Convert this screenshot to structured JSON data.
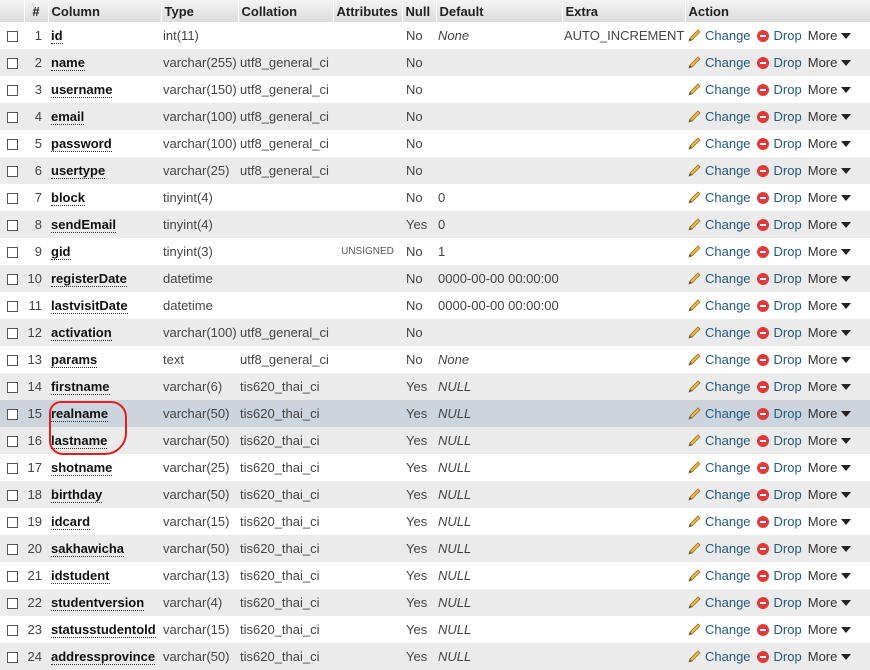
{
  "header": {
    "num": "#",
    "column": "Column",
    "type": "Type",
    "collation": "Collation",
    "attributes": "Attributes",
    "null": "Null",
    "default": "Default",
    "extra": "Extra",
    "action": "Action"
  },
  "actions": {
    "change": "Change",
    "drop": "Drop",
    "more": "More"
  },
  "rows": [
    {
      "num": "1",
      "column": "id",
      "type": "int(11)",
      "collation": "",
      "attributes": "",
      "null": "No",
      "default": "None",
      "extra": "AUTO_INCREMENT"
    },
    {
      "num": "2",
      "column": "name",
      "type": "varchar(255)",
      "collation": "utf8_general_ci",
      "attributes": "",
      "null": "No",
      "default": "",
      "extra": ""
    },
    {
      "num": "3",
      "column": "username",
      "type": "varchar(150)",
      "collation": "utf8_general_ci",
      "attributes": "",
      "null": "No",
      "default": "",
      "extra": ""
    },
    {
      "num": "4",
      "column": "email",
      "type": "varchar(100)",
      "collation": "utf8_general_ci",
      "attributes": "",
      "null": "No",
      "default": "",
      "extra": ""
    },
    {
      "num": "5",
      "column": "password",
      "type": "varchar(100)",
      "collation": "utf8_general_ci",
      "attributes": "",
      "null": "No",
      "default": "",
      "extra": ""
    },
    {
      "num": "6",
      "column": "usertype",
      "type": "varchar(25)",
      "collation": "utf8_general_ci",
      "attributes": "",
      "null": "No",
      "default": "",
      "extra": ""
    },
    {
      "num": "7",
      "column": "block",
      "type": "tinyint(4)",
      "collation": "",
      "attributes": "",
      "null": "No",
      "default": "0",
      "extra": ""
    },
    {
      "num": "8",
      "column": "sendEmail",
      "type": "tinyint(4)",
      "collation": "",
      "attributes": "",
      "null": "Yes",
      "default": "0",
      "extra": ""
    },
    {
      "num": "9",
      "column": "gid",
      "type": "tinyint(3)",
      "collation": "",
      "attributes": "UNSIGNED",
      "null": "No",
      "default": "1",
      "extra": ""
    },
    {
      "num": "10",
      "column": "registerDate",
      "type": "datetime",
      "collation": "",
      "attributes": "",
      "null": "No",
      "default": "0000-00-00 00:00:00",
      "extra": ""
    },
    {
      "num": "11",
      "column": "lastvisitDate",
      "type": "datetime",
      "collation": "",
      "attributes": "",
      "null": "No",
      "default": "0000-00-00 00:00:00",
      "extra": ""
    },
    {
      "num": "12",
      "column": "activation",
      "type": "varchar(100)",
      "collation": "utf8_general_ci",
      "attributes": "",
      "null": "No",
      "default": "",
      "extra": ""
    },
    {
      "num": "13",
      "column": "params",
      "type": "text",
      "collation": "utf8_general_ci",
      "attributes": "",
      "null": "No",
      "default": "None",
      "extra": ""
    },
    {
      "num": "14",
      "column": "firstname",
      "type": "varchar(6)",
      "collation": "tis620_thai_ci",
      "attributes": "",
      "null": "Yes",
      "default": "NULL",
      "extra": ""
    },
    {
      "num": "15",
      "column": "realname",
      "type": "varchar(50)",
      "collation": "tis620_thai_ci",
      "attributes": "",
      "null": "Yes",
      "default": "NULL",
      "extra": ""
    },
    {
      "num": "16",
      "column": "lastname",
      "type": "varchar(50)",
      "collation": "tis620_thai_ci",
      "attributes": "",
      "null": "Yes",
      "default": "NULL",
      "extra": ""
    },
    {
      "num": "17",
      "column": "shotname",
      "type": "varchar(25)",
      "collation": "tis620_thai_ci",
      "attributes": "",
      "null": "Yes",
      "default": "NULL",
      "extra": ""
    },
    {
      "num": "18",
      "column": "birthday",
      "type": "varchar(50)",
      "collation": "tis620_thai_ci",
      "attributes": "",
      "null": "Yes",
      "default": "NULL",
      "extra": ""
    },
    {
      "num": "19",
      "column": "idcard",
      "type": "varchar(15)",
      "collation": "tis620_thai_ci",
      "attributes": "",
      "null": "Yes",
      "default": "NULL",
      "extra": ""
    },
    {
      "num": "20",
      "column": "sakhawicha",
      "type": "varchar(50)",
      "collation": "tis620_thai_ci",
      "attributes": "",
      "null": "Yes",
      "default": "NULL",
      "extra": ""
    },
    {
      "num": "21",
      "column": "idstudent",
      "type": "varchar(13)",
      "collation": "tis620_thai_ci",
      "attributes": "",
      "null": "Yes",
      "default": "NULL",
      "extra": ""
    },
    {
      "num": "22",
      "column": "studentversion",
      "type": "varchar(4)",
      "collation": "tis620_thai_ci",
      "attributes": "",
      "null": "Yes",
      "default": "NULL",
      "extra": ""
    },
    {
      "num": "23",
      "column": "statusstudentold",
      "type": "varchar(15)",
      "collation": "tis620_thai_ci",
      "attributes": "",
      "null": "Yes",
      "default": "NULL",
      "extra": ""
    },
    {
      "num": "24",
      "column": "addressprovince",
      "type": "varchar(50)",
      "collation": "tis620_thai_ci",
      "attributes": "",
      "null": "Yes",
      "default": "NULL",
      "extra": ""
    }
  ],
  "highlighted_row": 15,
  "colors": {
    "header_bg": "#dcdcdc",
    "row_alt_bg": "#ebebeb",
    "row_highlight_bg": "#ccd4de",
    "action_link": "#235a81",
    "drop_icon": "#e03a3a",
    "annotation_circle": "#e32020"
  },
  "icons": {
    "change": "pencil-icon",
    "drop": "drop-icon",
    "more": "dropdown-arrow-icon"
  }
}
